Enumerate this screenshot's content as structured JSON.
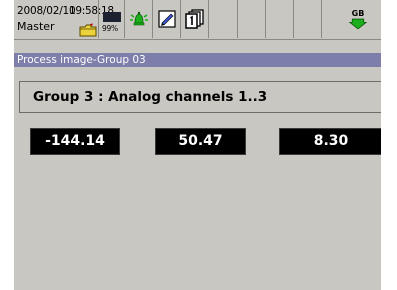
{
  "status_bar": {
    "date": "2008/02/11",
    "time": "09:58:18",
    "user": "Master",
    "memory_pct": "99%",
    "language": "GB",
    "icons": {
      "folder": "folder-icon",
      "disk": "memory-card-icon",
      "alarm": "alarm-bell-icon",
      "edit": "edit-note-icon",
      "pages": "page-stack-icon",
      "language": "language-switch-icon"
    }
  },
  "title_bar": {
    "title": "Process image-Group 03"
  },
  "group": {
    "header": "Group 3 : Analog channels 1..3",
    "channels": [
      {
        "value": "-144.14"
      },
      {
        "value": "50.47"
      },
      {
        "value": "8.30"
      }
    ]
  },
  "colors": {
    "screen_background": "#c9c7c1",
    "title_bar": "#7d7ea9",
    "value_tile": "#000000",
    "value_text": "#ffffff",
    "alarm_icon": "#1bb01b"
  }
}
